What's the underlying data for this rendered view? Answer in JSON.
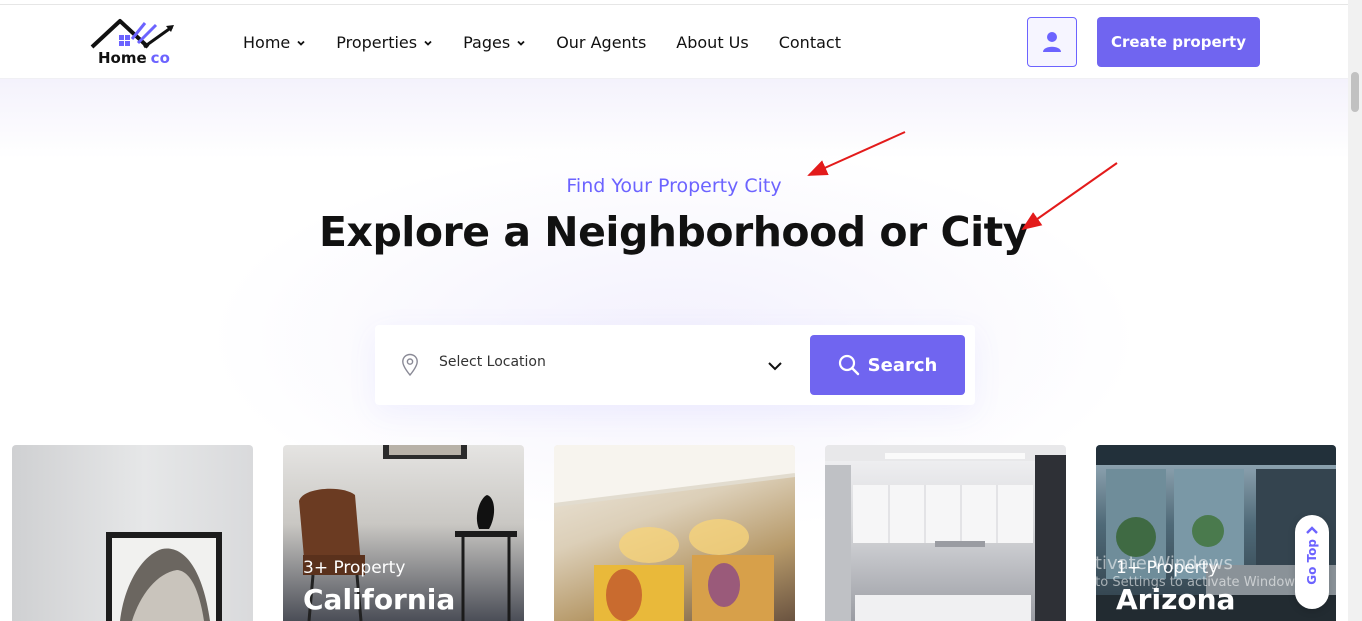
{
  "brand": {
    "name": "Home",
    "accent": "co"
  },
  "nav": {
    "items": [
      {
        "label": "Home",
        "dropdown": true
      },
      {
        "label": "Properties",
        "dropdown": true
      },
      {
        "label": "Pages",
        "dropdown": true
      },
      {
        "label": "Our Agents",
        "dropdown": false
      },
      {
        "label": "About Us",
        "dropdown": false
      },
      {
        "label": "Contact",
        "dropdown": false
      }
    ],
    "profile_icon": "user-icon",
    "create_label": "Create property"
  },
  "hero": {
    "subtitle": "Find Your Property City",
    "title": "Explore a Neighborhood or City"
  },
  "search": {
    "location_placeholder": "Select Location",
    "button_label": "Search"
  },
  "cities": [
    {
      "count": "",
      "name": ""
    },
    {
      "count": "3+ Property",
      "name": "California"
    },
    {
      "count": "",
      "name": ""
    },
    {
      "count": "",
      "name": ""
    },
    {
      "count": "1+ Property",
      "name": "Arizona"
    }
  ],
  "go_top": "Go Top",
  "watermark": {
    "line1": "Activate Windows",
    "line2": "Go to Settings to activate Windows."
  },
  "colors": {
    "accent": "#7065f0",
    "annotation_arrow": "#e31b1b"
  }
}
